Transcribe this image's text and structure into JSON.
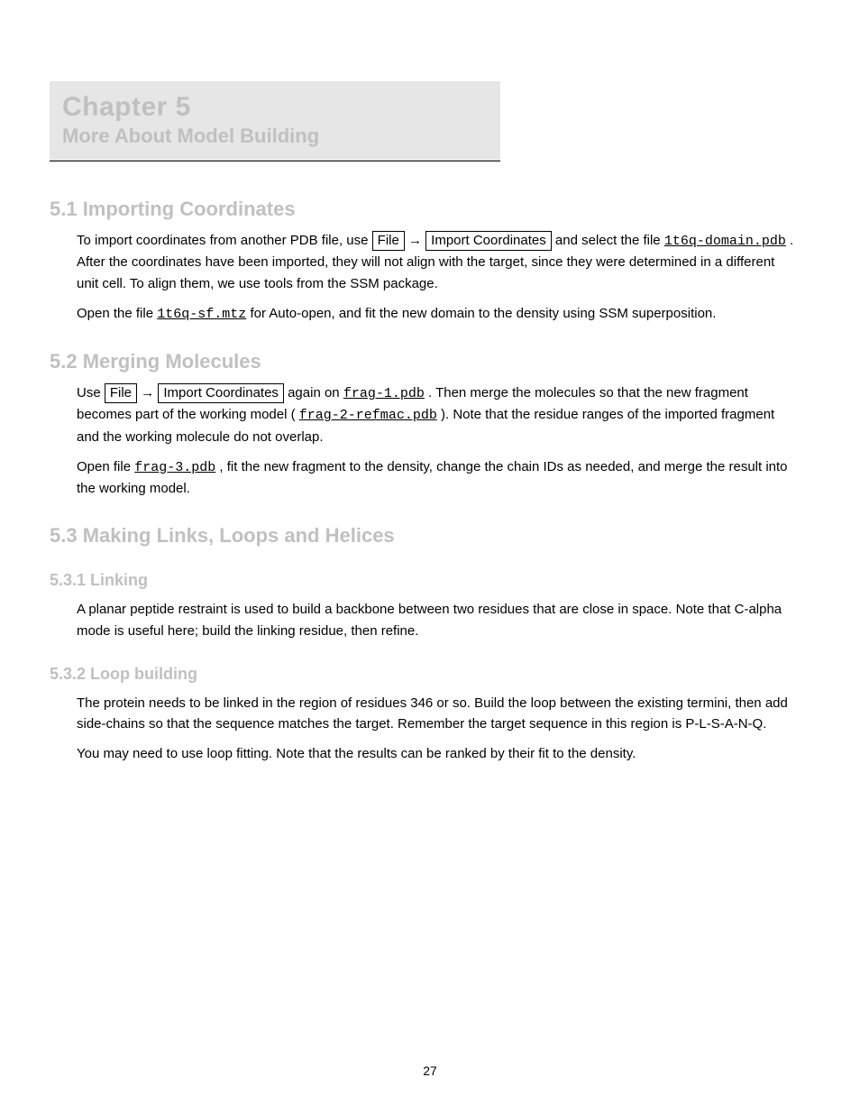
{
  "chapter": {
    "tag": "Chapter 5",
    "title": "More About Model Building"
  },
  "sections": {
    "s1": {
      "title": "5.1 Importing Coordinates",
      "p1_a": "To import coordinates from another PDB file, use ",
      "menu_file": "File",
      "p1_b": " → ",
      "menu_import": "Import Coordinates",
      "p1_c": " and select the file ",
      "file1": "1t6q-domain.pdb",
      "p1_d": ". After the coordinates have been imported, they will not align with the target, since they were determined in a different unit cell. To align them, we use tools from the SSM package.",
      "p2_a": "Open the file ",
      "file2": "1t6q-sf.mtz",
      "p2_b": " for Auto-open, and fit the new domain to the density using SSM superposition."
    },
    "s2": {
      "title": "5.2 Merging Molecules",
      "p1_a": "Use ",
      "menu_file2": "File",
      "p1_b": " → ",
      "menu_import2": "Import Coordinates",
      "p1_c": " again on ",
      "file3": "frag-1.pdb",
      "p1_d": ". Then merge the molecules so that the new fragment becomes part of the working model (",
      "file4": "frag-2-refmac.pdb",
      "p1_e": "). Note that the residue ranges of the imported fragment and the working molecule do not overlap.",
      "p2_a": "Open file ",
      "file5": "frag-3.pdb",
      "p2_b": ", fit the new fragment to the density, change the chain IDs as needed, and merge the result into the working model."
    },
    "s3": {
      "title": "5.3 Making Links, Loops and Helices",
      "sub1": {
        "title": "5.3.1 Linking",
        "p1": "A planar peptide restraint is used to build a backbone between two residues that are close in space. Note that C-alpha mode is useful here; build the linking residue, then refine."
      },
      "sub2": {
        "title": "5.3.2 Loop building",
        "p1": "The protein needs to be linked in the region of residues 346 or so. Build the loop between the existing termini, then add side-chains so that the sequence matches the target. Remember the target sequence in this region is P-L-S-A-N-Q.",
        "p2": "You may need to use loop fitting. Note that the results can be ranked by their fit to the density."
      }
    }
  },
  "page_number": "27"
}
